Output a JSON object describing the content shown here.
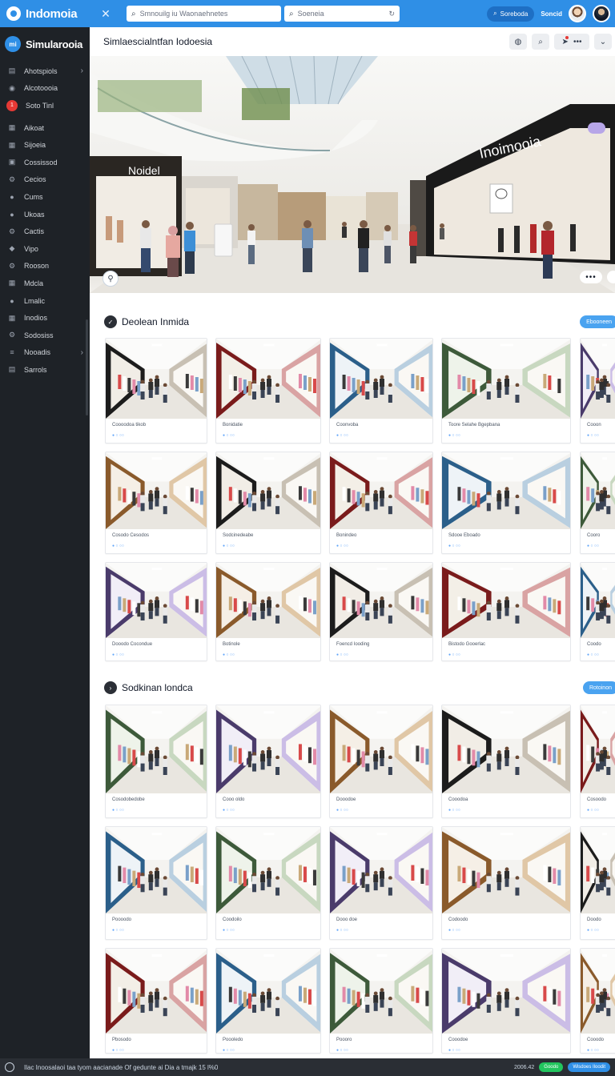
{
  "topbar": {
    "brand": "Indomoia",
    "search_primary": "Smnouilg iu Waonaehnetes",
    "search_secondary": "Soeneia",
    "action_button": "Soreboda",
    "link": "Soncid",
    "colors": {
      "bar": "#2f8fe6",
      "button": "#1e6fc4"
    }
  },
  "sidebar": {
    "logo_text": "mi",
    "title": "Simularooia",
    "items": [
      {
        "label": "Ahotspiols",
        "icon": "doc-icon",
        "chevron": "›"
      },
      {
        "label": "Alcotoooia",
        "icon": "circle-icon"
      },
      {
        "label": "Soto Tinl",
        "badge": "1"
      },
      {
        "label": "Aikoat",
        "icon": "grid-icon"
      },
      {
        "label": "Sijoeia",
        "icon": "grid-icon"
      },
      {
        "label": "Cossissod",
        "icon": "box-icon"
      },
      {
        "label": "Cecios",
        "icon": "gear-icon"
      },
      {
        "label": "Cums",
        "icon": "dot-icon"
      },
      {
        "label": "Ukoas",
        "icon": "dot-icon"
      },
      {
        "label": "Cactis",
        "icon": "gear-icon"
      },
      {
        "label": "Vipo",
        "icon": "tag-icon"
      },
      {
        "label": "Rooson",
        "icon": "gear-icon"
      },
      {
        "label": "Mdcla",
        "icon": "grid-icon"
      },
      {
        "label": "Lmalic",
        "icon": "dot-icon"
      },
      {
        "label": "Inodios",
        "icon": "grid-icon"
      },
      {
        "label": "Sodosiss",
        "icon": "gear-icon"
      },
      {
        "label": "Nooadis",
        "icon": "menu-icon",
        "chevron": "›"
      },
      {
        "label": "Sarrols",
        "icon": "doc-icon"
      }
    ]
  },
  "main": {
    "title": "Simlaescialntfan Iodoesia",
    "hero": {
      "sign_left": "Noidel",
      "sign_right": "Inoimooia"
    },
    "section1": {
      "title": "Deolean Inmida",
      "button": "Ebooneen"
    },
    "section2": {
      "title": "Sodkinan londca",
      "button": "Rotoinon"
    },
    "grid1_captions": [
      "Coooodoa tikob",
      "Bonidatie",
      "Coonvoba",
      "Toore Selahe Bgepbana",
      "Cooon",
      "Cosodo Cesodos",
      "Sodcinedeabe",
      "Bonindeo",
      "Sdooe Eboado",
      "Cooro",
      "Dooodo Cocondue",
      "Botinole",
      "Foencd Iooding",
      "Bistodo Gooerlac",
      "Coodo"
    ],
    "grid2_captions": [
      "Cosodobedobe",
      "Cooo oldo",
      "Dooodoe",
      "Cooodoa",
      "Cosoodo",
      "Poooodo",
      "Coodoilo",
      "Dooo doe",
      "Codoodo",
      "Doodo",
      "Pbosodo",
      "Poooledo",
      "Poooro",
      "Cooodoe",
      "Cooodo"
    ],
    "card_meta": "● ○ ○○"
  },
  "footer": {
    "status": "Ilac Inoosalaoi taa tyom aacianade Of gedunte ai Dia a tmajk 15 l%0",
    "number": "2006.42",
    "pill_green": "Goodo",
    "pill_blue": "Wisdoes Iloodit"
  }
}
